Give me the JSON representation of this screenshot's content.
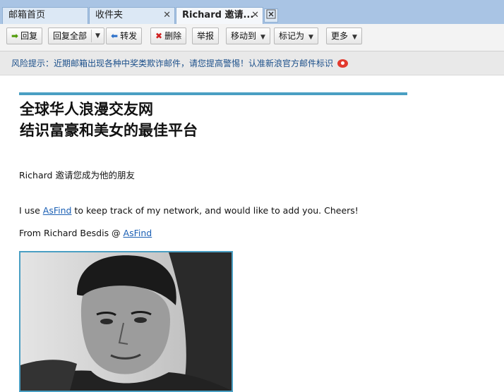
{
  "tabs": [
    {
      "label": "邮箱首页"
    },
    {
      "label": "收件夹",
      "close": "✕"
    },
    {
      "label": "Richard 邀请...",
      "close": "✕"
    }
  ],
  "toolbar": {
    "reply": "回复",
    "reply_all": "回复全部",
    "forward": "转发",
    "delete": "删除",
    "report": "举报",
    "move_to": "移动到",
    "mark_as": "标记为",
    "more": "更多"
  },
  "warning": {
    "text": "风险提示：近期邮箱出现各种中奖类欺诈邮件，请您提高警惕！认准新浪官方邮件标识"
  },
  "mail": {
    "headline_1": "全球华人浪漫交友网",
    "headline_2": "结识富豪和美女的最佳平台",
    "invite": "Richard 邀请您成为他的朋友",
    "body_before": "I use ",
    "body_link": "AsFind",
    "body_after": " to keep track of my network, and would like to add you. Cheers!",
    "from_before": "From Richard Besdis @ ",
    "from_link": "AsFind"
  },
  "colors": {
    "accent_line": "#4a9fc3",
    "link": "#1a5fb4",
    "tabbar": "#a9c4e4"
  }
}
